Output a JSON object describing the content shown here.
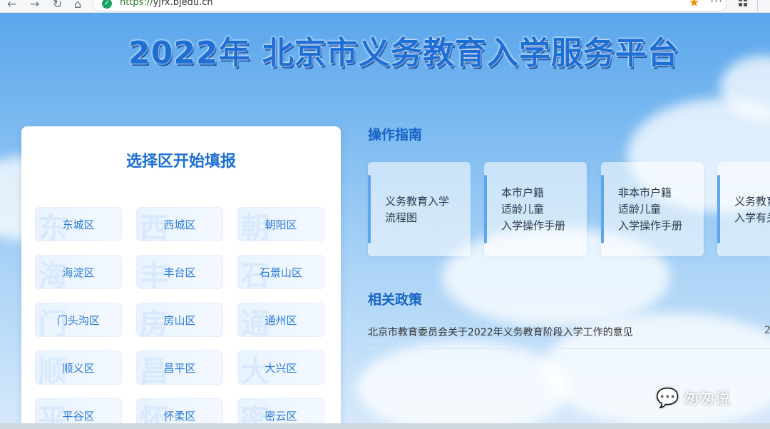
{
  "browser": {
    "url_scheme": "https://",
    "url_host": "yjrx.bjedu.cn",
    "menu_glyph": "···"
  },
  "header": {
    "title": "2022年 北京市义务教育入学服务平台"
  },
  "district_panel": {
    "title": "选择区开始填报",
    "districts": [
      {
        "label": "东城区",
        "wm": "东"
      },
      {
        "label": "西城区",
        "wm": "西"
      },
      {
        "label": "朝阳区",
        "wm": "朝"
      },
      {
        "label": "海淀区",
        "wm": "海"
      },
      {
        "label": "丰台区",
        "wm": "丰"
      },
      {
        "label": "石景山区",
        "wm": "石"
      },
      {
        "label": "门头沟区",
        "wm": "门"
      },
      {
        "label": "房山区",
        "wm": "房"
      },
      {
        "label": "通州区",
        "wm": "通"
      },
      {
        "label": "顺义区",
        "wm": "顺"
      },
      {
        "label": "昌平区",
        "wm": "昌"
      },
      {
        "label": "大兴区",
        "wm": "大"
      },
      {
        "label": "平谷区",
        "wm": "平"
      },
      {
        "label": "怀柔区",
        "wm": "怀"
      },
      {
        "label": "密云区",
        "wm": "密"
      }
    ]
  },
  "guide": {
    "title": "操作指南",
    "cards": [
      {
        "lines": [
          "义务教育入学",
          "流程图"
        ]
      },
      {
        "lines": [
          "本市户籍",
          "适龄儿童",
          "入学操作手册"
        ]
      },
      {
        "lines": [
          "非本市户籍",
          "适龄儿童",
          "入学操作手册"
        ]
      },
      {
        "lines": [
          "义务教育",
          "入学有关"
        ]
      }
    ]
  },
  "policy": {
    "title": "相关政策",
    "items": [
      {
        "title": "北京市教育委员会关于2022年义务教育阶段入学工作的意见",
        "date": "2"
      }
    ]
  },
  "watermark": {
    "icon": "wechat-icon",
    "text": "匆匆说"
  },
  "colors": {
    "accent": "#1b6fd3",
    "bar": "#5fa5e8"
  }
}
